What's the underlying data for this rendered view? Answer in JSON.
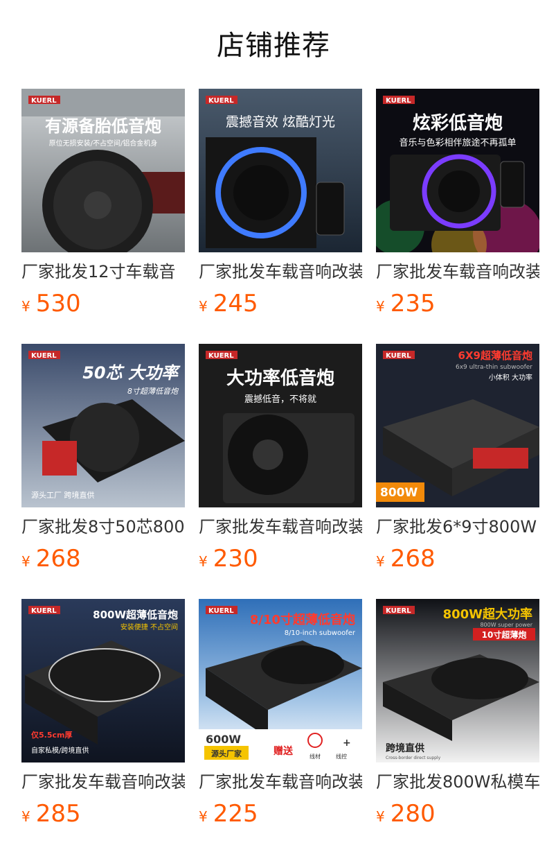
{
  "section": {
    "title": "店铺推荐"
  },
  "currency": "¥",
  "products": [
    {
      "title": "厂家批发12寸车载音",
      "price": "530",
      "image": {
        "brand": "KUERL",
        "headline": "有源备胎低音炮",
        "sub": "原位无损安装/不占空间/铝合金机身",
        "icon": "spare-tire-subwoofer-image"
      }
    },
    {
      "title": "厂家批发车载音响改装",
      "price": "245",
      "image": {
        "brand": "KUERL",
        "headline": "震撼音效 炫酷灯光",
        "icon": "rgb-subwoofer-image"
      }
    },
    {
      "title": "厂家批发车载音响改装",
      "price": "235",
      "image": {
        "brand": "KUERL",
        "headline": "炫彩低音炮",
        "sub": "音乐与色彩相伴旅途不再孤单",
        "icon": "colorful-subwoofer-image"
      }
    },
    {
      "title": "厂家批发8寸50芯800",
      "price": "268",
      "image": {
        "brand": "KUERL",
        "headline": "50芯 大功率",
        "sub": "8寸超薄低音炮",
        "badge": "源头工厂 跨境直供",
        "icon": "slim-subwoofer-image"
      }
    },
    {
      "title": "厂家批发车载音响改装",
      "price": "230",
      "image": {
        "brand": "KUERL",
        "headline": "大功率低音炮",
        "sub": "震撼低音，不将就",
        "icon": "high-power-subwoofer-image"
      }
    },
    {
      "title": "厂家批发6*9寸800W",
      "price": "268",
      "image": {
        "brand": "KUERL",
        "headline": "6X9超薄低音炮",
        "sub": "6x9 ultra-thin subwoofer",
        "tag": "小体积 大功率",
        "badge": "800W",
        "icon": "ultra-thin-subwoofer-image"
      }
    },
    {
      "title": "厂家批发车载音响改装",
      "price": "285",
      "image": {
        "brand": "KUERL",
        "headline": "800W超薄低音炮",
        "sub": "安装便捷 不占空间",
        "tag": "仅5.5cm厚",
        "badge": "自家私模/跨境直供",
        "icon": "800w-subwoofer-image"
      }
    },
    {
      "title": "厂家批发车载音响改装",
      "price": "225",
      "image": {
        "brand": "KUERL",
        "headline": "8/10寸超薄低音炮",
        "sub": "8/10-inch subwoofer",
        "tag": "600W",
        "badge": "源头厂家",
        "gift": "赠送",
        "gift_a": "线材",
        "gift_b": "线控",
        "icon": "10-inch-subwoofer-image"
      }
    },
    {
      "title": "厂家批发800W私模车",
      "price": "280",
      "image": {
        "brand": "KUERL",
        "headline": "800W超大功率",
        "sub": "800W super power",
        "tag": "10寸超薄炮",
        "badge": "跨境直供",
        "badge_sub": "Cross-border direct supply",
        "icon": "super-power-subwoofer-image"
      }
    }
  ]
}
